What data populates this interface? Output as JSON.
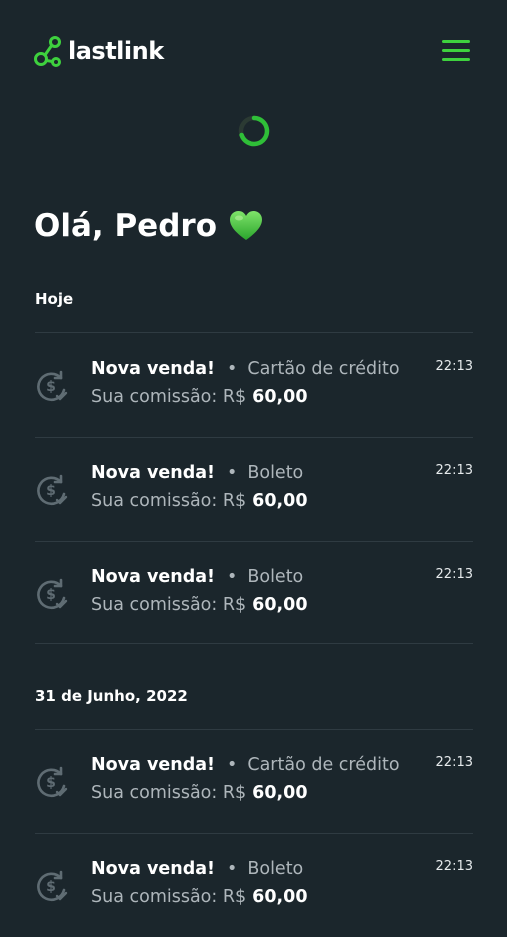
{
  "brand": {
    "name": "lastlink",
    "accent": "#3ed13e"
  },
  "header": {
    "menu_icon": "hamburger-menu-icon"
  },
  "greeting": {
    "text": "Olá, Pedro",
    "emoji": "green-heart"
  },
  "sections": [
    {
      "label": "Hoje",
      "items": [
        {
          "title": "Nova venda!",
          "method": "Cartão de crédito",
          "commission_label": "Sua comissão: R$",
          "amount": "60,00",
          "time": "22:13"
        },
        {
          "title": "Nova venda!",
          "method": "Boleto",
          "commission_label": "Sua comissão: R$",
          "amount": "60,00",
          "time": "22:13"
        },
        {
          "title": "Nova venda!",
          "method": "Boleto",
          "commission_label": "Sua comissão: R$",
          "amount": "60,00",
          "time": "22:13"
        }
      ]
    },
    {
      "label": "31 de Junho, 2022",
      "items": [
        {
          "title": "Nova venda!",
          "method": "Cartão de crédito",
          "commission_label": "Sua comissão: R$",
          "amount": "60,00",
          "time": "22:13"
        },
        {
          "title": "Nova venda!",
          "method": "Boleto",
          "commission_label": "Sua comissão: R$",
          "amount": "60,00",
          "time": "22:13"
        }
      ]
    }
  ],
  "separator": "•"
}
